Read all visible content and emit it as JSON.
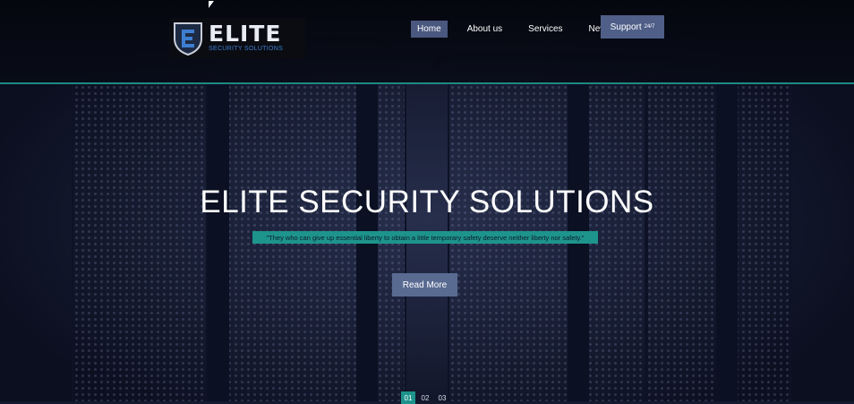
{
  "logo": {
    "main": "ELITE",
    "sub": "SECURITY SOLUTIONS"
  },
  "nav": {
    "items": [
      {
        "label": "Home",
        "active": true
      },
      {
        "label": "About us",
        "active": false
      },
      {
        "label": "Services",
        "active": false
      },
      {
        "label": "News",
        "active": false
      }
    ],
    "support_label": "Support",
    "support_suffix": "24/7"
  },
  "hero": {
    "title": "ELITE SECURITY SOLUTIONS",
    "quote": "\"They who can give up essential liberty to obtain a little temporary safety deserve neither liberty nor safety.\"",
    "button_label": "Read More"
  },
  "pager": {
    "items": [
      "01",
      "02",
      "03"
    ],
    "active_index": 0
  },
  "colors": {
    "accent": "#1d948c",
    "nav_active": "#4a587f",
    "button": "#5a6b92",
    "logo_blue": "#3d7ed1"
  }
}
